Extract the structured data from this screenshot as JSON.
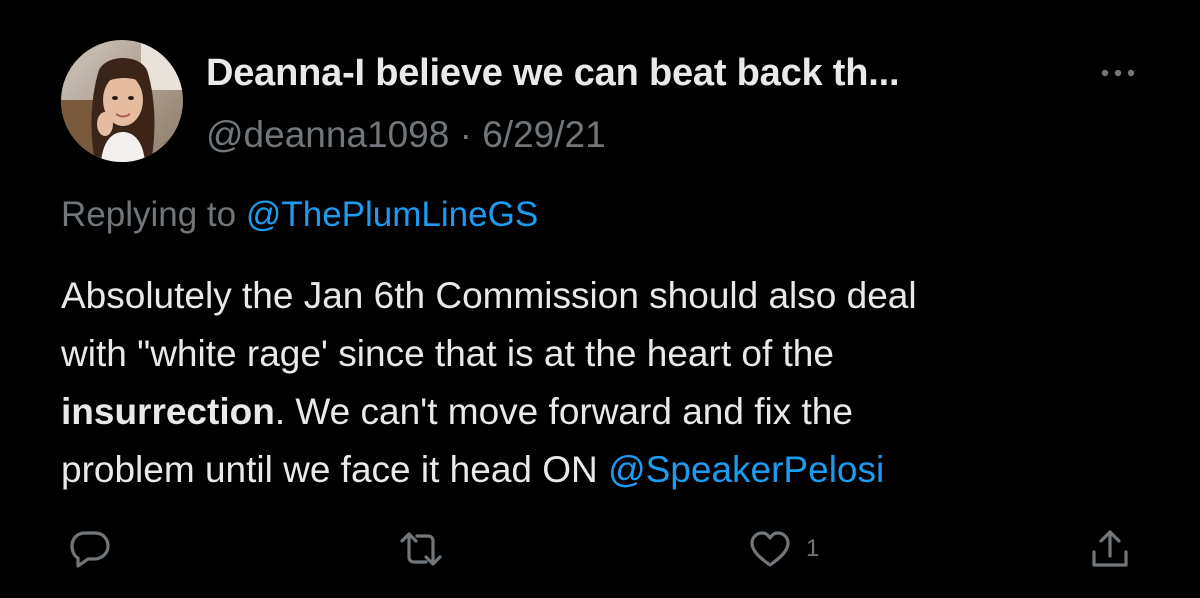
{
  "tweet": {
    "author_name": "Deanna-I believe we can beat back th...",
    "handle": "@deanna1098",
    "separator": "·",
    "date": "6/29/21",
    "replying_prefix": "Replying to",
    "replying_mention": "@ThePlumLineGS",
    "body": {
      "line1": "Absolutely the Jan 6th Commission should also deal",
      "line2": "with \"white rage' since that is at the heart of the",
      "line3_bold": "insurrection",
      "line3_rest": ".  We can't move forward and fix the",
      "line4_text": "problem until we face it head ON ",
      "line4_mention": "@SpeakerPelosi"
    },
    "actions": {
      "reply_icon": "reply-icon",
      "retweet_icon": "retweet-icon",
      "like_icon": "heart-icon",
      "like_count": "1",
      "share_icon": "share-icon"
    },
    "more_icon": "more-icon"
  },
  "colors": {
    "background": "#000000",
    "text": "#e7e9ea",
    "secondary": "#71767b",
    "link": "#1d9bf0"
  }
}
